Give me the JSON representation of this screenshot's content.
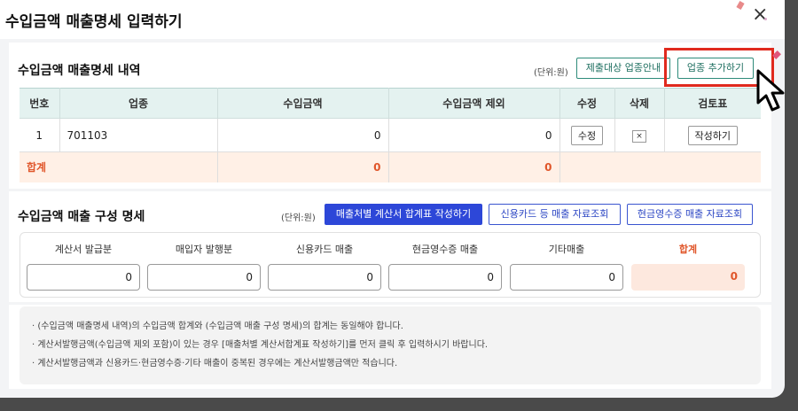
{
  "modal": {
    "title": "수입금액 매출명세 입력하기",
    "close": "×"
  },
  "detail": {
    "title": "수입금액 매출명세 내역",
    "unit": "(단위:원)",
    "guide_button": "제출대상 업종안내",
    "add_button": "업종 추가하기",
    "columns": [
      "번호",
      "업종",
      "수입금액",
      "수입금액 제외",
      "수정",
      "삭제",
      "검토표"
    ],
    "rows": [
      {
        "no": "1",
        "industry": "701103",
        "income": "0",
        "excluded": "0",
        "edit": "수정",
        "delete": "×",
        "review": "작성하기"
      }
    ],
    "total": {
      "label": "합계",
      "income": "0",
      "excluded": "0"
    }
  },
  "composition": {
    "title": "수입금액 매출 구성 명세",
    "unit": "(단위:원)",
    "invoice_summary_button": "매출처별 계산서 합계표 작성하기",
    "card_lookup_button": "신용카드 등 매출 자료조회",
    "cash_receipt_button": "현금영수증 매출 자료조회",
    "fields": [
      {
        "label": "계산서 발급분",
        "value": "0"
      },
      {
        "label": "매입자 발행분",
        "value": "0"
      },
      {
        "label": "신용카드 매출",
        "value": "0"
      },
      {
        "label": "현금영수증 매출",
        "value": "0"
      },
      {
        "label": "기타매출",
        "value": "0"
      },
      {
        "label": "합계",
        "value": "0"
      }
    ]
  },
  "notes": [
    "· (수입금액 매출명세 내역)의 수입금액 합계와 (수입금액 매출 구성 명세)의 합계는 동일해야 합니다.",
    "· 계산서발행금액(수입금액 제외 포함)이 있는 경우 [매출처별 계산서합계표 작성하기]를 먼저 클릭 후 입력하시기 바랍니다.",
    "· 계산서발행금액과 신용카드·현금영수증·기타 매출이 중복된 경우에는 계산서발행금액만 적습니다."
  ],
  "colors": {
    "accent_teal": "#2e8b7a",
    "primary_blue": "#2d47d8",
    "total_orange": "#e0562a",
    "highlight_red": "#e02a1e"
  },
  "icons": [
    "close-icon",
    "cursor-icon"
  ]
}
